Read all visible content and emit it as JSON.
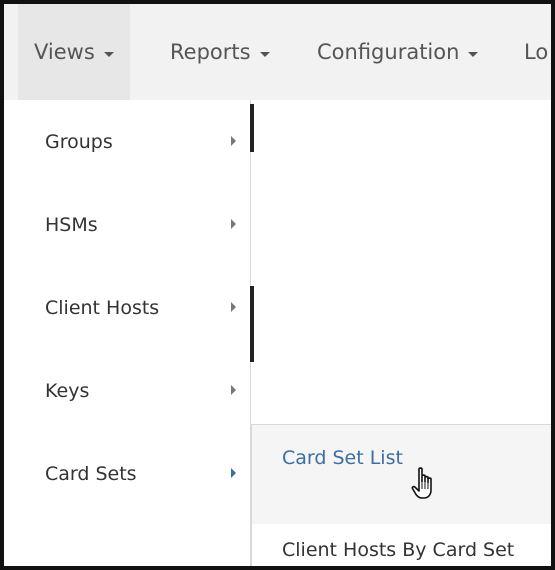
{
  "navbar": {
    "items": [
      {
        "label": "Views"
      },
      {
        "label": "Reports"
      },
      {
        "label": "Configuration"
      },
      {
        "label": "Lo"
      }
    ]
  },
  "views_menu": {
    "items": [
      {
        "label": "Groups",
        "arrow_icon": "chevron-right-icon"
      },
      {
        "label": "HSMs",
        "arrow_icon": "chevron-right-icon"
      },
      {
        "label": "Client Hosts",
        "arrow_icon": "chevron-right-icon"
      },
      {
        "label": "Keys",
        "arrow_icon": "chevron-right-icon"
      },
      {
        "label": "Card Sets",
        "arrow_icon": "chevron-right-icon"
      }
    ]
  },
  "card_sets_submenu": {
    "items": [
      {
        "label": "Card Set List"
      },
      {
        "label": "Client Hosts By Card Set"
      }
    ]
  },
  "colors": {
    "link_blue": "#3a6ea5",
    "navbar_bg": "#f2f2f2",
    "text": "#333333"
  },
  "cursor": {
    "icon": "hand-pointer-icon"
  }
}
